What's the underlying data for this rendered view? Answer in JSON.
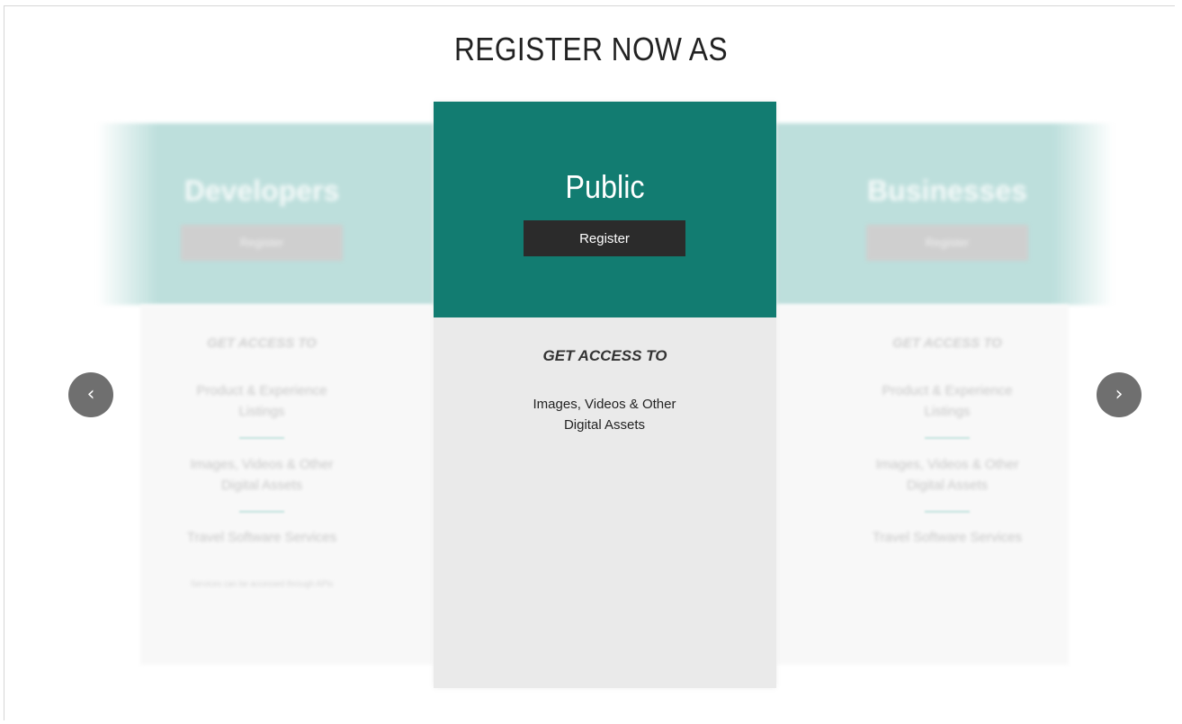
{
  "page": {
    "title": "REGISTER NOW AS"
  },
  "carousel": {
    "prev_icon": "‹",
    "next_icon": "›",
    "cards": [
      {
        "title": "Developers",
        "button_label": "Register",
        "access_title": "GET ACCESS TO",
        "items": [
          "Product & Experience Listings",
          "Images, Videos & Other Digital Assets",
          "Travel Software Services"
        ],
        "footnote": "Services can be accessed through APIs"
      },
      {
        "title": "Public",
        "button_label": "Register",
        "access_title": "GET ACCESS TO",
        "items": [
          "Images, Videos & Other Digital Assets"
        ]
      },
      {
        "title": "Businesses",
        "button_label": "Register",
        "access_title": "GET ACCESS TO",
        "items": [
          "Product & Experience Listings",
          "Images, Videos & Other Digital Assets",
          "Travel Software Services"
        ]
      }
    ]
  },
  "colors": {
    "accent": "#127c71",
    "button": "#2b2b2b",
    "card_body": "#eaeaea",
    "arrow": "#6f6f6f"
  }
}
